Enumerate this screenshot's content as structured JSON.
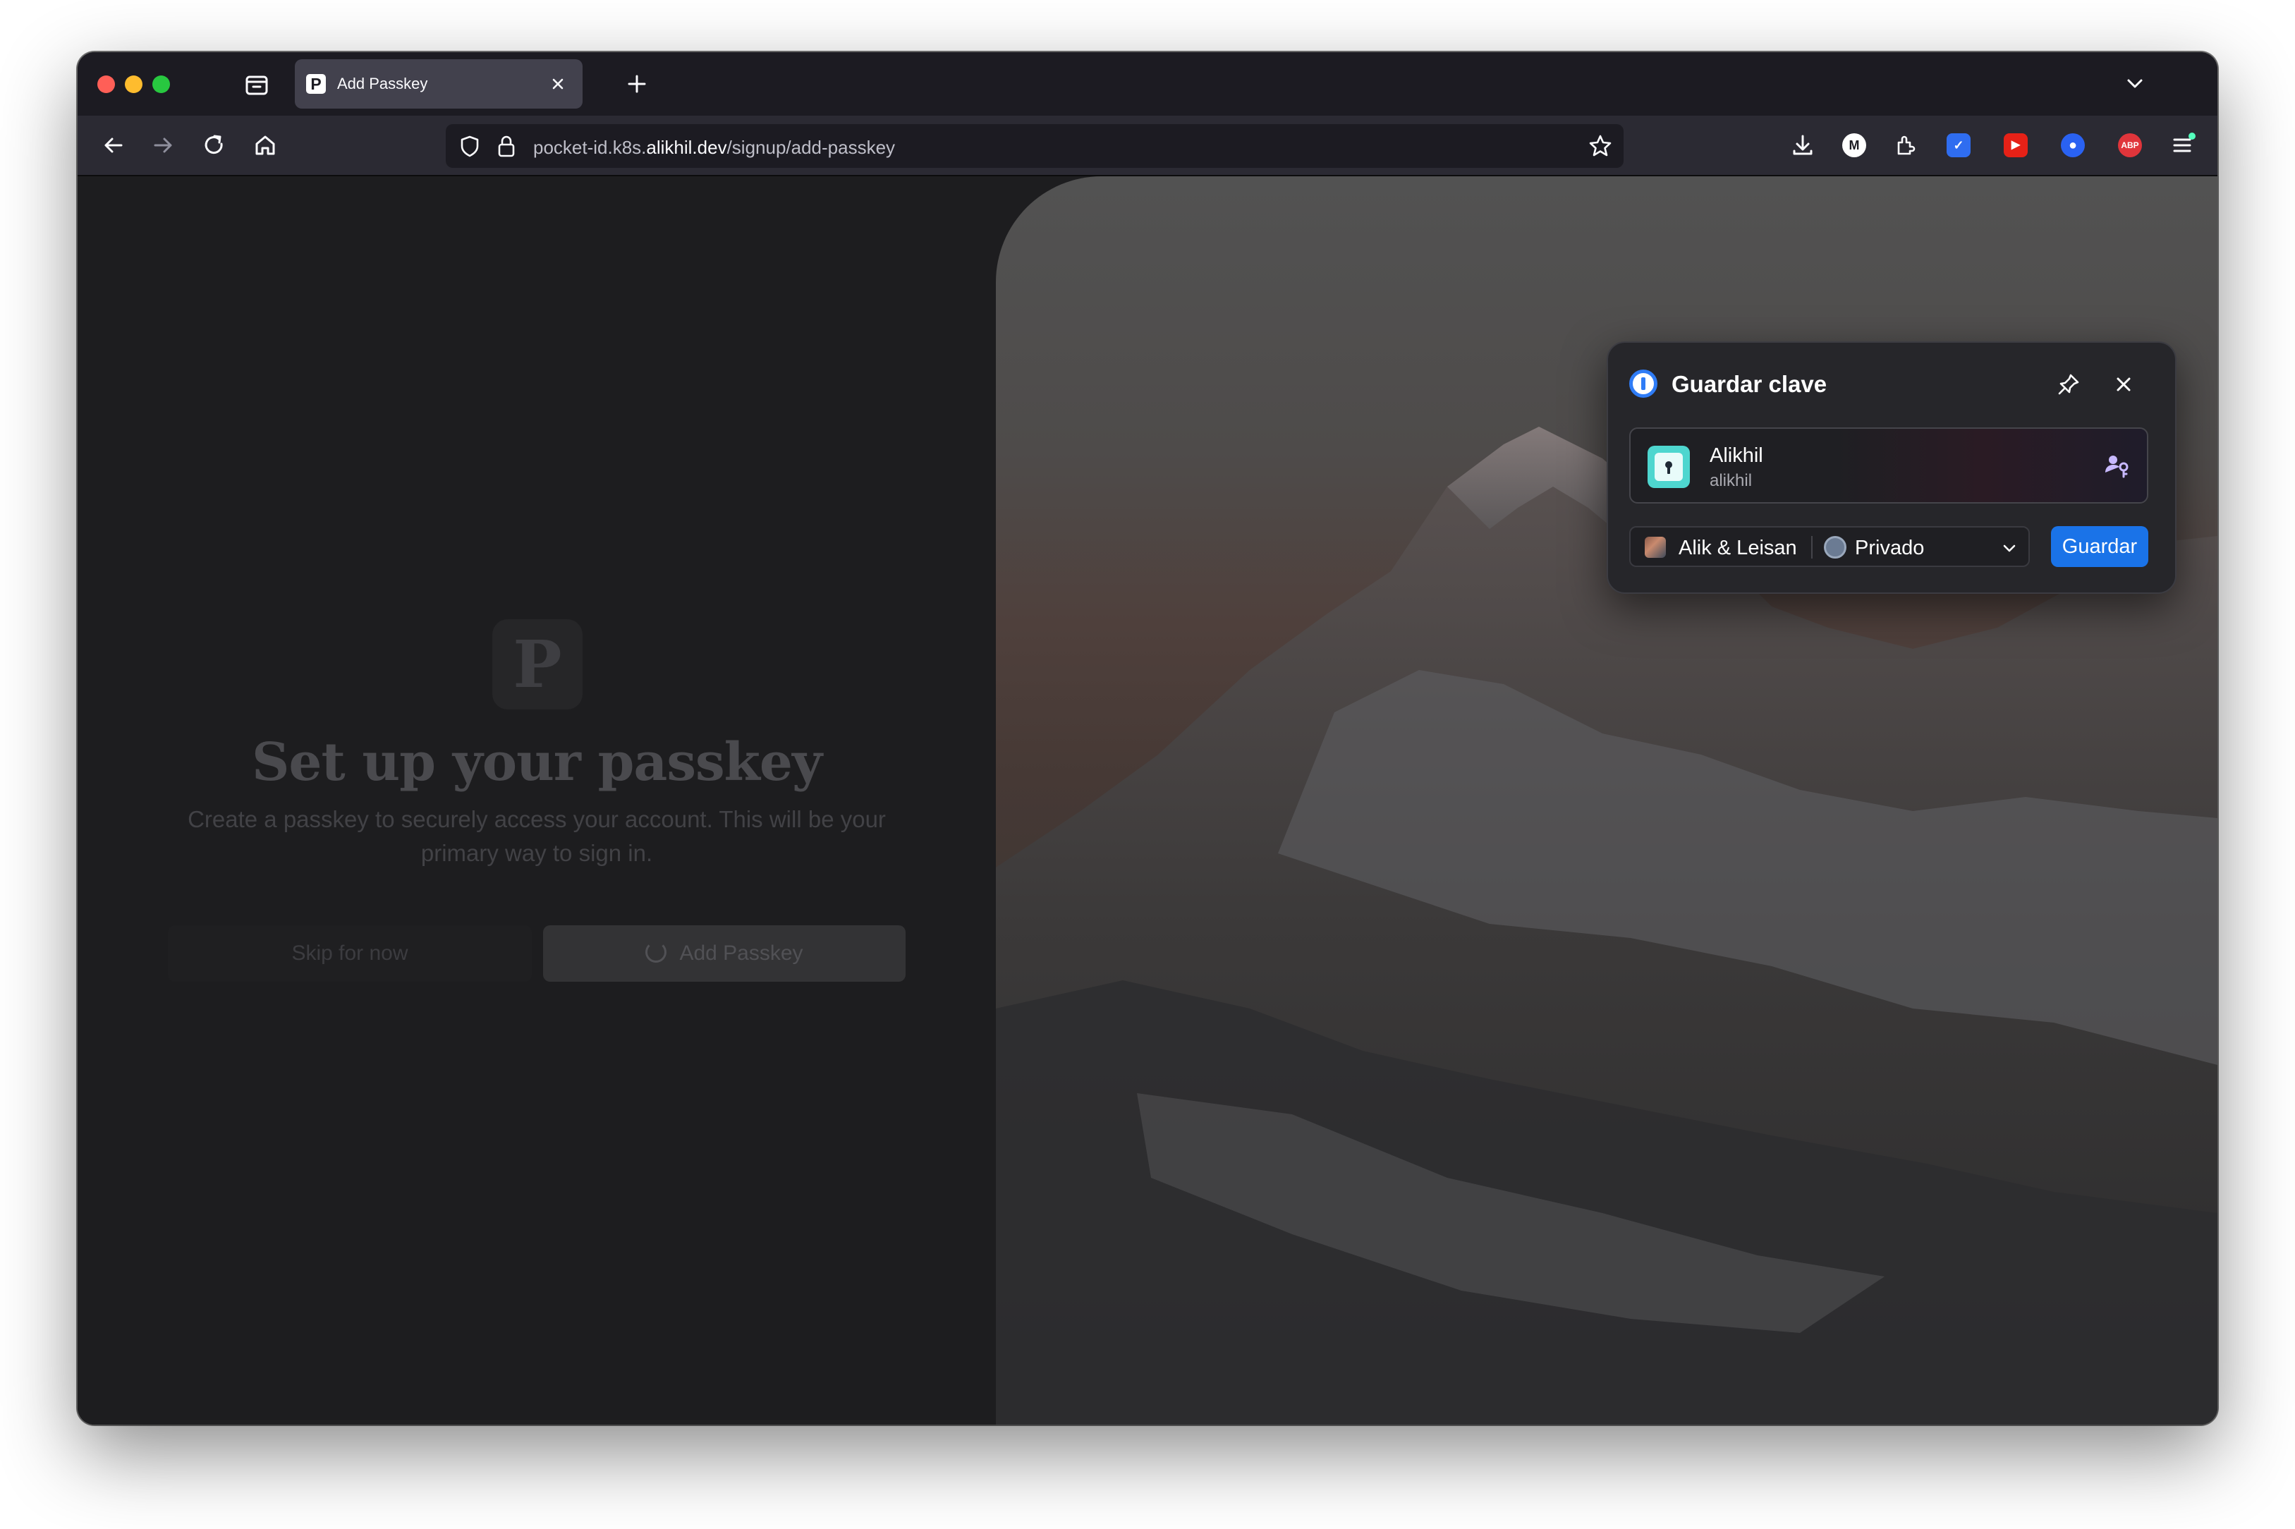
{
  "browser": {
    "tab": {
      "favicon": "P",
      "title": "Add Passkey"
    },
    "address_bar": {
      "url_prefix": "pocket-id.k8s.",
      "url_domain": "alikhil.dev",
      "url_path": "/signup/add-passkey"
    },
    "icons": [
      "tab-overview-icon",
      "close-icon",
      "plus-icon",
      "chevron-down-icon",
      "back-icon",
      "forward-icon",
      "reload-icon",
      "home-icon",
      "shield-icon",
      "lock-icon",
      "star-icon",
      "download-icon",
      "extensions-icon",
      "menu-icon"
    ],
    "extensions": [
      {
        "name": "m-extension",
        "text": "M",
        "color": "#ffffff"
      },
      {
        "name": "check-extension",
        "text": "✓",
        "color": "#2f6df0"
      },
      {
        "name": "youtube-extension",
        "text": "▶",
        "color": "#e62117"
      },
      {
        "name": "circle-extension",
        "text": "●",
        "color": "#2a62f2"
      },
      {
        "name": "abp-extension",
        "text": "ABP",
        "color": "#e0353b"
      }
    ]
  },
  "page": {
    "logo_letter": "P",
    "heading": "Set up your passkey",
    "subtitle": "Create a passkey to securely access your account. This will be your primary way to sign in.",
    "skip_label": "Skip for now",
    "add_label": "Add Passkey"
  },
  "popup": {
    "title": "Guardar clave",
    "item": {
      "name": "Alikhil",
      "username": "alikhil"
    },
    "owner": "Alik & Leisan",
    "vault": "Privado",
    "save_label": "Guardar",
    "accent_color": "#1a73e8"
  }
}
